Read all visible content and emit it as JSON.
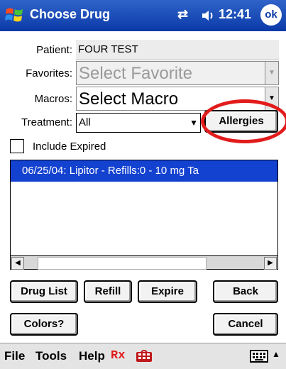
{
  "titlebar": {
    "title": "Choose Drug",
    "time": "12:41",
    "ok_label": "ok",
    "connectivity_icon": "connectivity-icon",
    "volume_icon": "volume-icon"
  },
  "form": {
    "patient_label": "Patient:",
    "patient_value": "FOUR TEST",
    "favorites_label": "Favorites:",
    "favorites_value": "Select Favorite",
    "macros_label": "Macros:",
    "macros_value": "Select Macro",
    "treatment_label": "Treatment:",
    "treatment_value": "All",
    "allergies_button": "Allergies",
    "include_expired_label": "Include Expired",
    "include_expired_checked": false
  },
  "list": {
    "items": [
      "06/25/04: Lipitor - Refills:0 - 10 mg Ta"
    ]
  },
  "buttons": {
    "drug_list": "Drug List",
    "refill": "Refill",
    "expire": "Expire",
    "back": "Back",
    "colors": "Colors?",
    "cancel": "Cancel"
  },
  "menubar": {
    "file": "File",
    "tools": "Tools",
    "help": "Help",
    "rx": "Rx"
  },
  "colors": {
    "titlebar": "#0b3aa8",
    "selection": "#1442d0",
    "annotation_circle": "#e21b1b",
    "rx_text": "#e21b1b"
  }
}
